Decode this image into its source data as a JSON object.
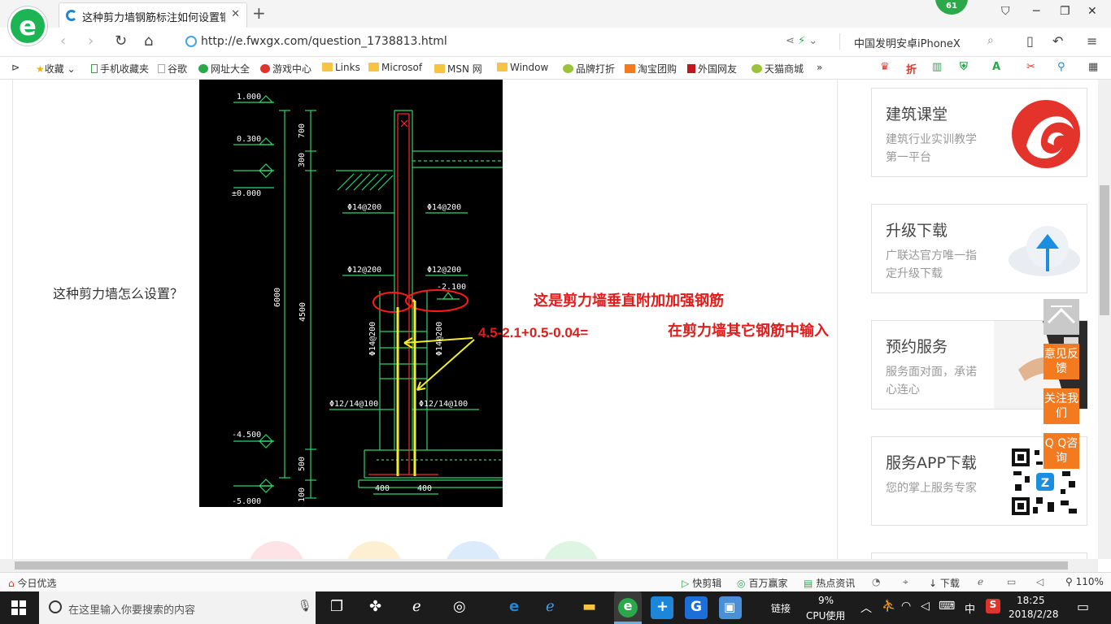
{
  "browser": {
    "tab_title": "这种剪力墙钢筋标注如何设置钢筋",
    "notification_count": "61",
    "url": "http://e.fwxgx.com/question_1738813.html",
    "search_text": "中国发明安卓iPhoneX",
    "bookmarks": [
      "收藏",
      "手机收藏夹",
      "谷歌",
      "网址大全",
      "游戏中心",
      "Links",
      "Microsof",
      "MSN 网",
      "Window",
      "品牌打折",
      "淘宝团购",
      "外国网友",
      "天猫商城"
    ]
  },
  "page": {
    "question": "这种剪力墙怎么设置？",
    "annotations": {
      "vertical_rebar": "这是剪力墙垂直附加加强钢筋",
      "input_other": "在剪力墙其它钢筋中输入",
      "formula": "4.5-2.1+0.5-0.04="
    },
    "cad": {
      "elevations": [
        "1.000",
        "0.300",
        "±0.000",
        "-4.500",
        "-5.000"
      ],
      "dims": [
        "700",
        "300",
        "6000",
        "4500",
        "500",
        "100"
      ],
      "rebar_labels": [
        "Φ14@200",
        "Φ14@200",
        "Φ12@200",
        "Φ12@200",
        "Φ14@200",
        "Φ14@200",
        "Φ12/14@100",
        "Φ12/14@100"
      ],
      "level_mark": "-2.100",
      "bottom_dims": [
        "400",
        "400"
      ]
    }
  },
  "sidebar": {
    "cards": [
      {
        "title": "建筑课堂",
        "subtitle": "建筑行业实训教学第一平台"
      },
      {
        "title": "升级下载",
        "subtitle": "广联达官方唯一指定升级下载"
      },
      {
        "title": "预约服务",
        "subtitle": "服务面对面，承诺心连心"
      },
      {
        "title": "服务APP下载",
        "subtitle": "您的掌上服务专家"
      }
    ],
    "float_buttons": [
      "意见反馈",
      "关注我们",
      "Q Q咨询"
    ]
  },
  "statusbar": {
    "left": "今日优选",
    "items": [
      "快剪辑",
      "百万赢家",
      "热点资讯",
      "下载"
    ],
    "zoom": "110%"
  },
  "taskbar": {
    "search_placeholder": "在这里输入你要搜索的内容",
    "links": "链接",
    "cpu_percent": "9%",
    "cpu_label": "CPU使用",
    "ime": "中",
    "time": "18:25",
    "date": "2018/2/28"
  },
  "colors": {
    "accent_green": "#2aa84a",
    "annotation_red": "#e21b1b",
    "float_orange": "#f47a1f",
    "cad_green": "#2fd36a",
    "cad_yellow": "#f1ee2a"
  }
}
